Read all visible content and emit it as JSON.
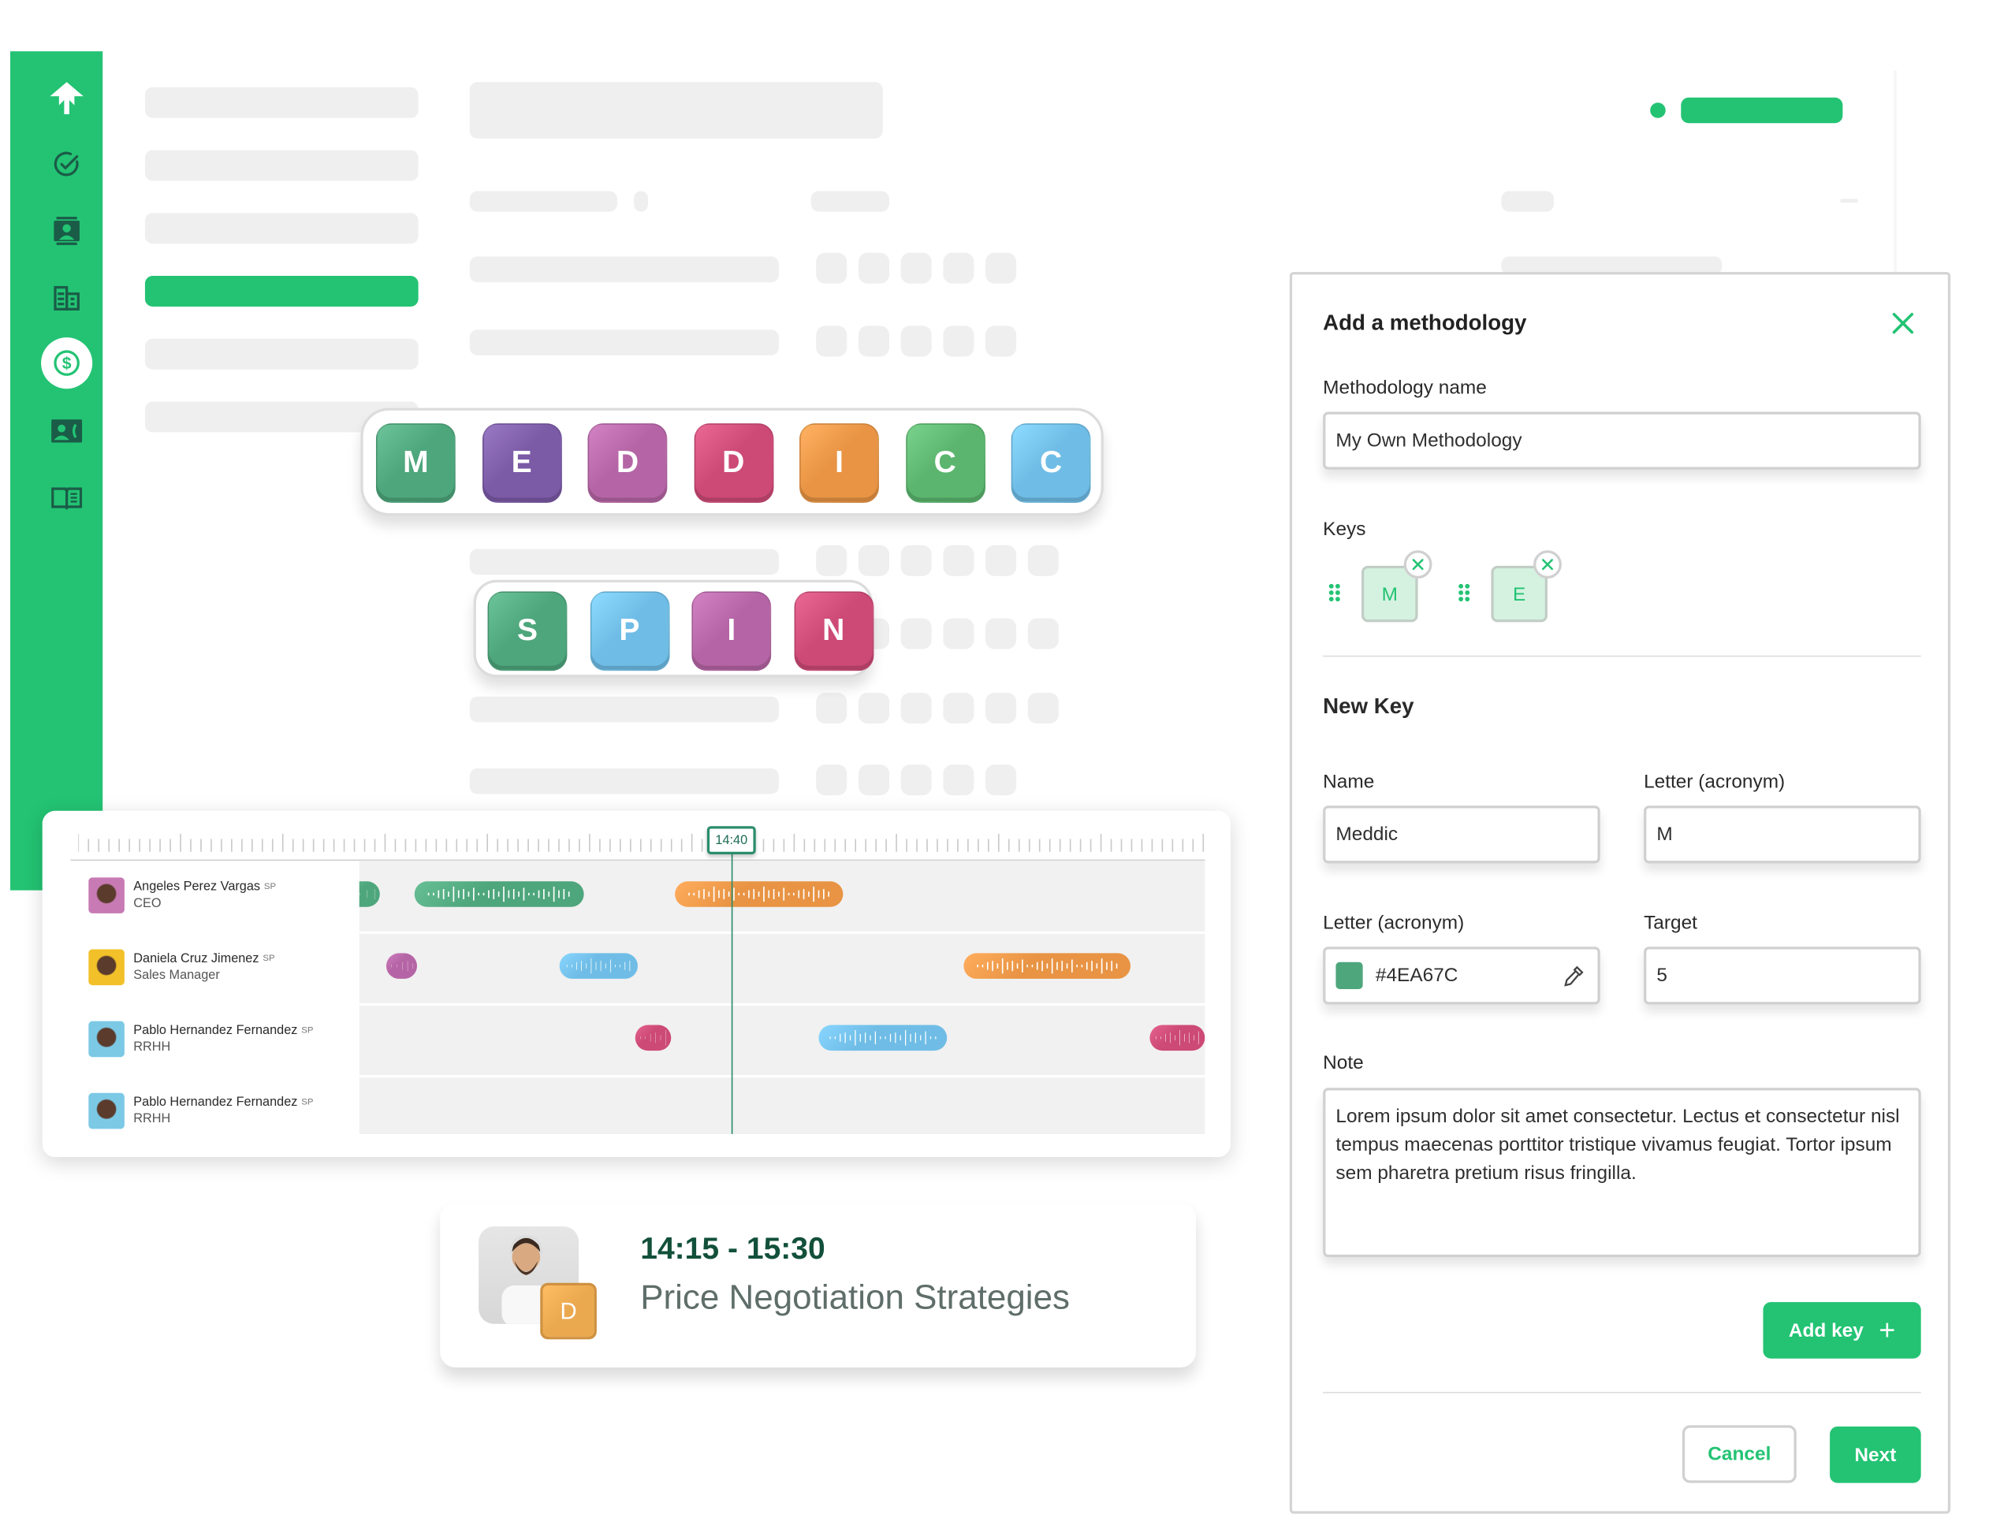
{
  "brand": {
    "accent": "#23C373",
    "dark": "#1A5C47"
  },
  "sidebar": {
    "items": [
      {
        "icon": "logo-icon",
        "active": false
      },
      {
        "icon": "tasks-check-icon",
        "active": false
      },
      {
        "icon": "contacts-icon",
        "active": false
      },
      {
        "icon": "companies-icon",
        "active": false
      },
      {
        "icon": "deals-dollar-icon",
        "active": true
      },
      {
        "icon": "calls-icon",
        "active": false
      },
      {
        "icon": "playbook-book-icon",
        "active": false
      }
    ]
  },
  "methodologies": [
    {
      "name": "MEDDICC",
      "keys": [
        {
          "letter": "M",
          "color": "#4EA67C"
        },
        {
          "letter": "E",
          "color": "#7B5AA6"
        },
        {
          "letter": "D",
          "color": "#B565A5"
        },
        {
          "letter": "D",
          "color": "#CD4A76"
        },
        {
          "letter": "I",
          "color": "#E89444"
        },
        {
          "letter": "C",
          "color": "#5BB56E"
        },
        {
          "letter": "C",
          "color": "#6FBDE6"
        }
      ]
    },
    {
      "name": "SPIN",
      "keys": [
        {
          "letter": "S",
          "color": "#4EA67C"
        },
        {
          "letter": "P",
          "color": "#6FBDE6"
        },
        {
          "letter": "I",
          "color": "#B565A5"
        },
        {
          "letter": "N",
          "color": "#CD4A76"
        }
      ]
    }
  ],
  "timeline": {
    "playhead": "14:40",
    "people": [
      {
        "name": "Angeles Perez Vargas",
        "lang": "SP",
        "role": "CEO",
        "avatar_color": "#c77ab3",
        "segments": [
          {
            "start": 0.0,
            "end": 0.025,
            "color": "#4EA67C"
          },
          {
            "start": 0.065,
            "end": 0.265,
            "color": "#4EA67C"
          },
          {
            "start": 0.373,
            "end": 0.572,
            "color": "#E89444"
          }
        ]
      },
      {
        "name": "Daniela Cruz Jimenez",
        "lang": "SP",
        "role": "Sales Manager",
        "avatar_color": "#f2c029",
        "segments": [
          {
            "start": 0.032,
            "end": 0.069,
            "color": "#B565A5"
          },
          {
            "start": 0.237,
            "end": 0.33,
            "color": "#6FBDE6"
          },
          {
            "start": 0.714,
            "end": 0.912,
            "color": "#E89444"
          }
        ]
      },
      {
        "name": "Pablo Hernandez Fernandez",
        "lang": "SP",
        "role": "RRHH",
        "avatar_color": "#7cc9e6",
        "segments": [
          {
            "start": 0.326,
            "end": 0.368,
            "color": "#CD4A76"
          },
          {
            "start": 0.543,
            "end": 0.695,
            "color": "#6FBDE6"
          },
          {
            "start": 0.935,
            "end": 1.0,
            "color": "#CD4A76"
          }
        ]
      },
      {
        "name": "Pablo Hernandez Fernandez",
        "lang": "SP",
        "role": "RRHH",
        "avatar_color": "#7cc9e6",
        "segments": []
      }
    ]
  },
  "event": {
    "time_range": "14:15 - 15:30",
    "title": "Price Negotiation Strategies",
    "badge_letter": "D",
    "badge_color": "#EBA94F"
  },
  "dialog": {
    "title": "Add a methodology",
    "methodology_name_label": "Methodology name",
    "methodology_name_value": "My Own Methodology",
    "keys_label": "Keys",
    "keys": [
      {
        "letter": "M"
      },
      {
        "letter": "E"
      }
    ],
    "new_key_heading": "New Key",
    "name_label": "Name",
    "name_value": "Meddic",
    "letter_label": "Letter (acronym)",
    "letter_value": "M",
    "color_label": "Letter (acronym)",
    "color_value": "#4EA67C",
    "target_label": "Target",
    "target_value": "5",
    "note_label": "Note",
    "note_value": "Lorem ipsum dolor sit amet consectetur. Lectus et consectetur nisl tempus maecenas porttitor tristique vivamus feugiat. Tortor ipsum sem pharetra pretium risus fringilla.",
    "add_key_label": "Add key",
    "cancel_label": "Cancel",
    "next_label": "Next"
  }
}
